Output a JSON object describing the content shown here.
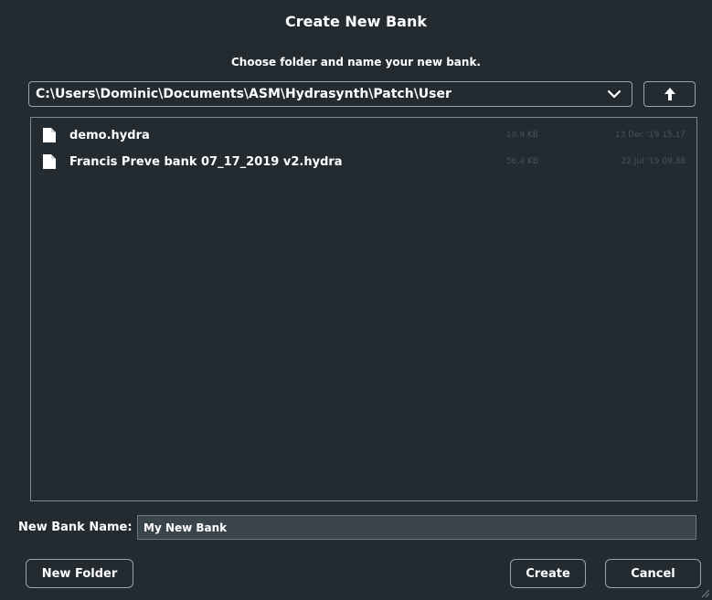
{
  "dialog": {
    "title": "Create New Bank",
    "subtitle": "Choose folder and name your new bank."
  },
  "path": {
    "value": "C:\\Users\\Dominic\\Documents\\ASM\\Hydrasynth\\Patch\\User",
    "dropdown_icon": "chevron-down-icon",
    "up_icon": "arrow-up-icon"
  },
  "files": [
    {
      "name": "demo.hydra",
      "size": "18.9 KB",
      "date": "13 Dec '19 15.17",
      "icon": "file-icon"
    },
    {
      "name": "Francis Preve bank 07_17_2019 v2.hydra",
      "size": "56.4 KB",
      "date": "22 Jul '19 09.38",
      "icon": "file-icon"
    }
  ],
  "bank_name": {
    "label": "New Bank Name:",
    "value": "My New Bank"
  },
  "buttons": {
    "new_folder": "New Folder",
    "create": "Create",
    "cancel": "Cancel"
  },
  "colors": {
    "background": "#232a30",
    "border": "#9aa4ab",
    "input_background": "#3a444b",
    "dim_text": "#49535a",
    "text": "#ffffff"
  }
}
